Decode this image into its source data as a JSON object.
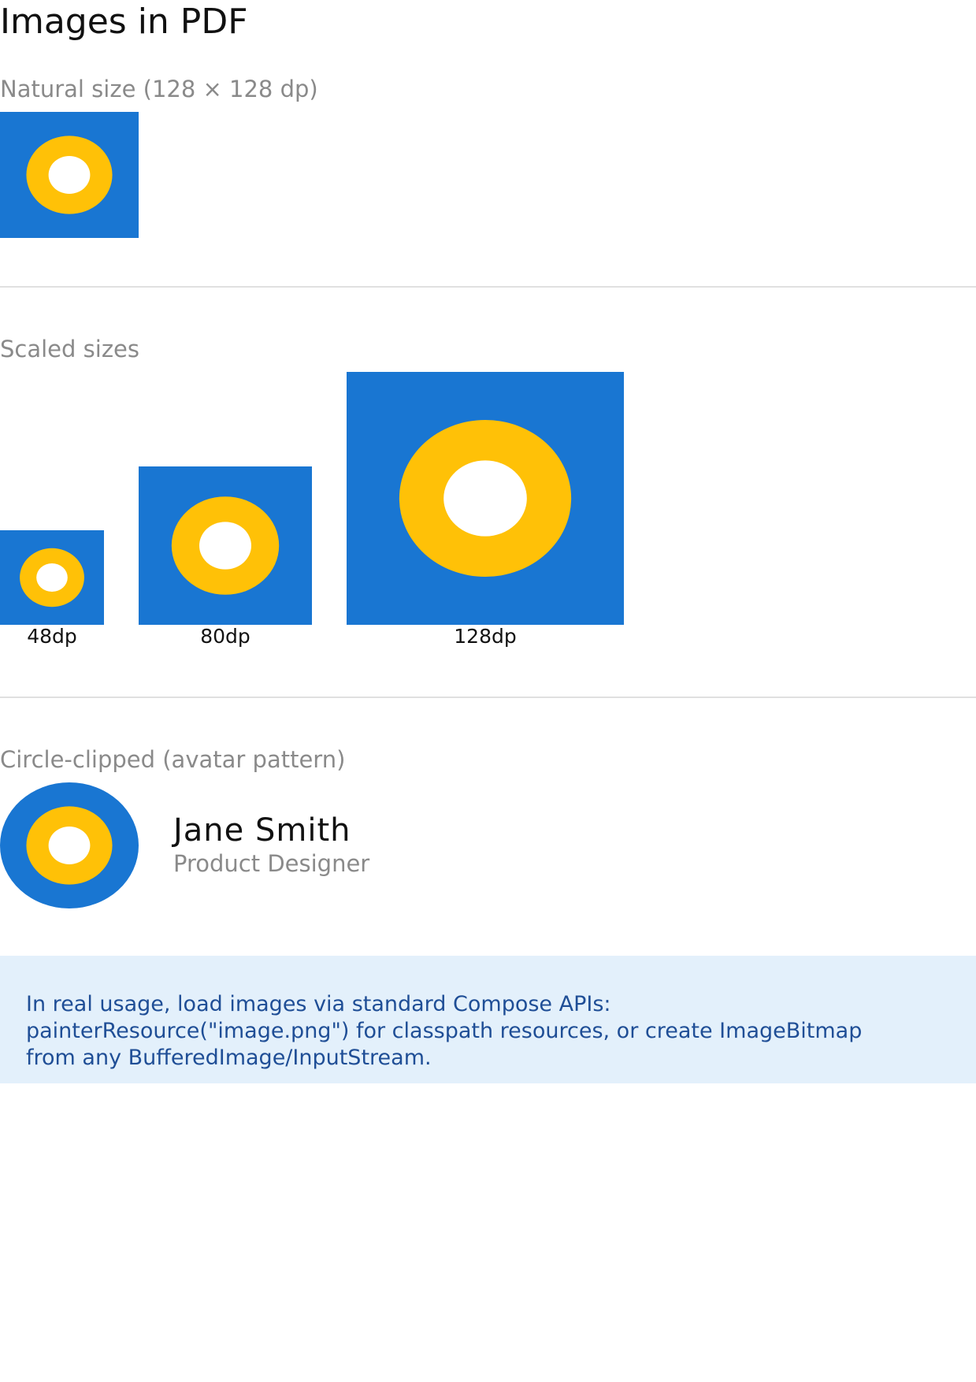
{
  "page": {
    "title": "Images in PDF"
  },
  "sections": {
    "natural": {
      "label": "Natural size (128 × 128 dp)"
    },
    "scaled": {
      "label": "Scaled sizes",
      "items": [
        {
          "caption": "48dp"
        },
        {
          "caption": "80dp"
        },
        {
          "caption": "128dp"
        }
      ]
    },
    "circle": {
      "label": "Circle-clipped (avatar pattern)",
      "name": "Jane Smith",
      "role": "Product Designer"
    }
  },
  "note": {
    "lines": [
      "In real usage, load images via standard Compose APIs:",
      "painterResource(\"image.png\") for classpath resources, or create ImageBitmap",
      "from any BufferedImage/InputStream."
    ]
  },
  "colors": {
    "image_background": "#1976d2",
    "ring": "#ffc107",
    "center": "#ffffff",
    "note_background": "#e3f0fb",
    "note_text": "#1f4e96",
    "label_grey": "#8a8a8a"
  }
}
